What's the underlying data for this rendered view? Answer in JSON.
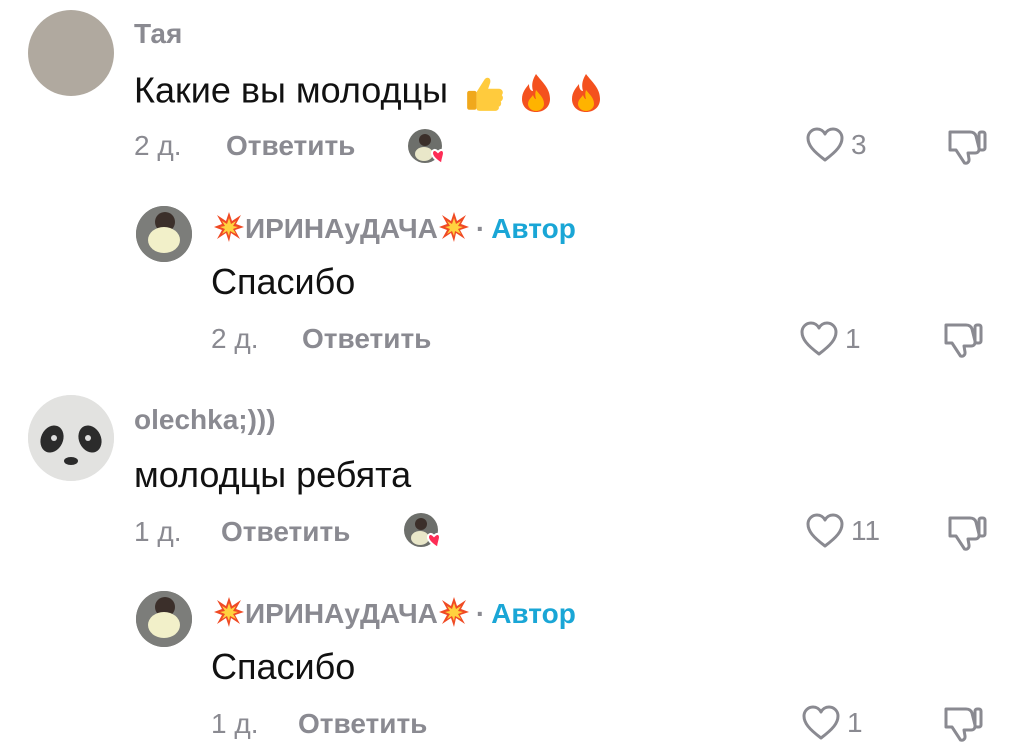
{
  "comments": [
    {
      "username": "Тая",
      "text": "Какие вы молодцы",
      "emojis": [
        "thumbs-up",
        "fire",
        "fire"
      ],
      "time": "2 д.",
      "reply_label": "Ответить",
      "likes": "3",
      "liked_by_author": true
    },
    {
      "username": "ИРИНАуДАЧА",
      "username_decoration": "collision-emoji",
      "author_label": "Автор",
      "separator": "·",
      "text": "Спасибо",
      "time": "2 д.",
      "reply_label": "Ответить",
      "likes": "1"
    },
    {
      "username": "olechka;)))",
      "text": "молодцы ребята",
      "time": "1 д.",
      "reply_label": "Ответить",
      "likes": "11",
      "liked_by_author": true
    },
    {
      "username": "ИРИНАуДАЧА",
      "username_decoration": "collision-emoji",
      "author_label": "Автор",
      "separator": "·",
      "text": "Спасибо",
      "time": "1 д.",
      "reply_label": "Ответить",
      "likes": "1"
    }
  ],
  "colors": {
    "secondary_text": "#8a8a91",
    "author_accent": "#1aa6d6",
    "heart_badge": "#fe2c55"
  }
}
